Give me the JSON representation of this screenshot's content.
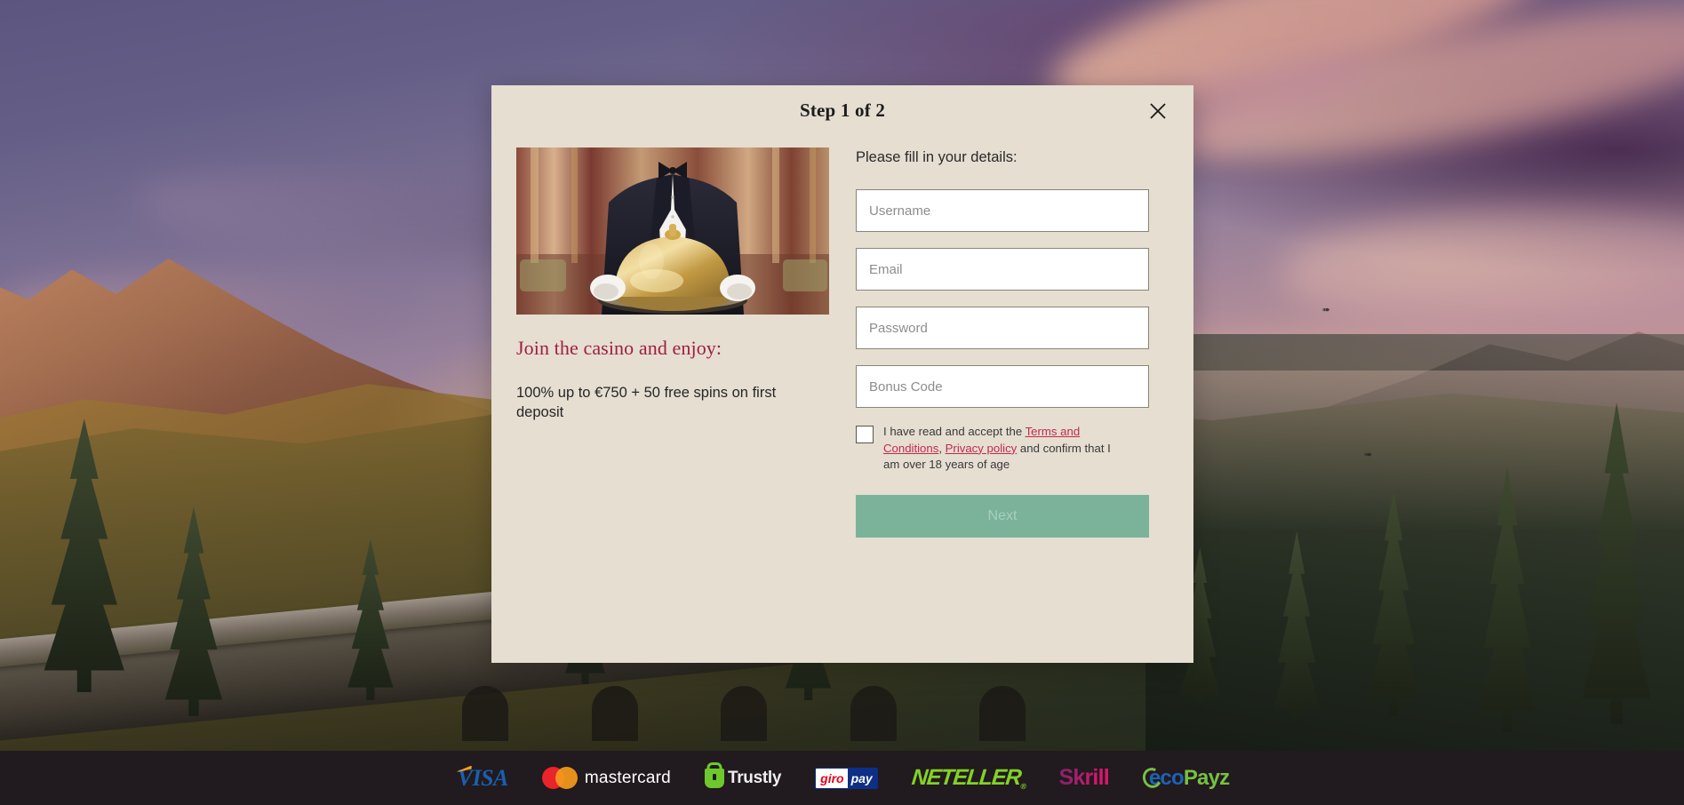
{
  "background": {
    "scene_description": "Alpine autumn valley at sunset with purple-pink clouds, stone railway viaduct and conifer forest"
  },
  "modal": {
    "title": "Step 1 of 2",
    "close_icon": "close-x-icon",
    "promo": {
      "image_alt": "butler-holding-cloche",
      "heading": "Join the casino and enjoy:",
      "subtext": "100% up to €750 + 50 free spins on first deposit"
    },
    "form": {
      "intro": "Please fill in your details:",
      "fields": [
        {
          "name": "username",
          "placeholder": "Username",
          "value": "",
          "type": "text"
        },
        {
          "name": "email",
          "placeholder": "Email",
          "value": "",
          "type": "text"
        },
        {
          "name": "password",
          "placeholder": "Password",
          "value": "",
          "type": "password"
        },
        {
          "name": "bonus_code",
          "placeholder": "Bonus Code",
          "value": "",
          "type": "text"
        }
      ],
      "terms": {
        "checked": false,
        "part1": "I have read and accept the ",
        "link1": "Terms and Conditions",
        "separator": ", ",
        "link2": "Privacy policy",
        "part2": " and confirm that I am over 18 years of age"
      },
      "submit_label": "Next"
    }
  },
  "footer": {
    "payment_methods": [
      {
        "name": "visa",
        "label": "VISA"
      },
      {
        "name": "mastercard",
        "label": "mastercard"
      },
      {
        "name": "trustly",
        "label": "Trustly"
      },
      {
        "name": "giropay",
        "label_a": "giro",
        "label_b": "pay"
      },
      {
        "name": "neteller",
        "label": "NETELLER",
        "mark": "®"
      },
      {
        "name": "skrill",
        "label": "Skrill"
      },
      {
        "name": "ecopayz",
        "label_a": "eco",
        "label_b": "Payz"
      }
    ]
  },
  "colors": {
    "modal_bg": "#e5ded1",
    "accent_crimson": "#a01e40",
    "link_red": "#c4294f",
    "button_green": "#7bb29a",
    "footer_bg": "#211a1e"
  }
}
